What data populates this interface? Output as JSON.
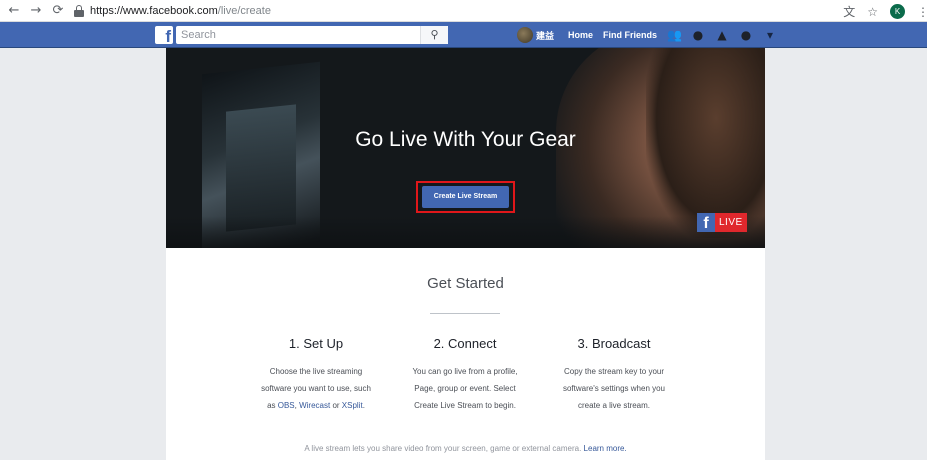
{
  "browser": {
    "url_host": "https://www.facebook.com",
    "url_path": "/live/create",
    "profile_initial": "K"
  },
  "fb": {
    "search_placeholder": "Search",
    "username": "建益",
    "home": "Home",
    "find_friends": "Find Friends"
  },
  "hero": {
    "title": "Go Live With Your Gear",
    "cta": "Create Live Stream",
    "badge_text": "LIVE"
  },
  "get_started": {
    "title": "Get Started",
    "steps": [
      {
        "title": "1. Set Up",
        "lines": [
          "Choose the live streaming",
          "software you want to use, such"
        ],
        "last_prefix": "as ",
        "links": [
          "OBS",
          "Wirecast",
          "XSplit"
        ],
        "or": " or ",
        "comma": ", ",
        "period": "."
      },
      {
        "title": "2. Connect",
        "lines": [
          "You can go live from a profile,",
          "Page, group or event. Select",
          "Create Live Stream to begin."
        ]
      },
      {
        "title": "3. Broadcast",
        "lines": [
          "Copy the stream key to your",
          "software's settings when you",
          "create a live stream."
        ]
      }
    ],
    "footnote": "A live stream lets you share video from your screen, game or external camera. ",
    "learn_more": "Learn more."
  },
  "colors": {
    "fb_blue": "#4267b2",
    "highlight_red": "#e0171a",
    "live_red": "#e0282d",
    "link_blue": "#365899"
  }
}
